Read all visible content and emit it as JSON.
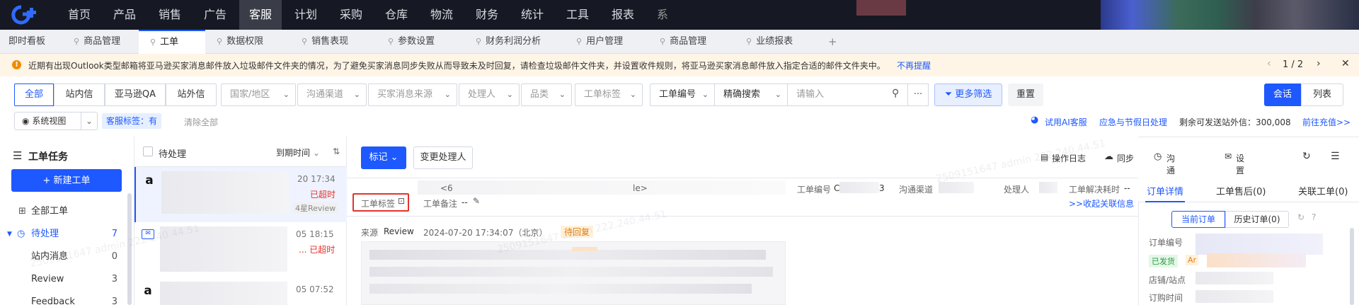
{
  "topnav": {
    "items": [
      "首页",
      "产品",
      "销售",
      "广告",
      "客服",
      "计划",
      "采购",
      "仓库",
      "物流",
      "财务",
      "统计",
      "工具",
      "报表",
      "系"
    ],
    "active_index": 4
  },
  "tabs": [
    {
      "label": "即时看板",
      "pinned": false
    },
    {
      "label": "商品管理",
      "pinned": true
    },
    {
      "label": "工单",
      "pinned": true,
      "active": true
    },
    {
      "label": "数据权限",
      "pinned": true
    },
    {
      "label": "销售表现",
      "pinned": true
    },
    {
      "label": "参数设置",
      "pinned": true
    },
    {
      "label": "财务利润分析",
      "pinned": true
    },
    {
      "label": "用户管理",
      "pinned": true
    },
    {
      "label": "商品管理",
      "pinned": true
    },
    {
      "label": "业绩报表",
      "pinned": true
    }
  ],
  "tab_add": "+",
  "notice": {
    "text": "近期有出现Outlook类型邮箱将亚马逊买家消息邮件放入垃圾邮件文件夹的情况，为了避免买家消息同步失败从而导致未及时回复，请检查垃圾邮件文件夹，并设置收件规则，将亚马逊买家消息邮件放入指定合适的邮件文件夹中。",
    "dismiss": "不再提醒",
    "pager": "1 / 2"
  },
  "filters": {
    "segments": [
      "全部",
      "站内信",
      "亚马逊QA",
      "站外信"
    ],
    "selects": [
      "国家/地区",
      "沟通渠道",
      "买家消息来源",
      "处理人",
      "品类",
      "工单标签"
    ],
    "ticket_no_label": "工单编号",
    "match_mode": "精确搜索",
    "search_placeholder": "请输入",
    "more_filter": "更多筛选",
    "reset": "重置",
    "view_modes": [
      "会话",
      "列表"
    ]
  },
  "row2": {
    "system_view": "系统视图",
    "tag_chip": "客服标签：有",
    "clear_all": "清除全部",
    "ai_service": "试用AI客服",
    "emergency": "应急与节假日处理",
    "quota": "剩余可发送站外信：300,008",
    "recharge": "前往充值>>"
  },
  "sidebar": {
    "title": "工单任务",
    "new_button": "+ 新建工单",
    "all": "全部工单",
    "pending": {
      "label": "待处理",
      "count": "7"
    },
    "children": [
      {
        "label": "站内消息",
        "count": "0"
      },
      {
        "label": "Review",
        "count": "3"
      },
      {
        "label": "Feedback",
        "count": "3"
      }
    ]
  },
  "list": {
    "header_label": "待处理",
    "sort_label": "到期时间",
    "items": [
      {
        "time": "20 17:34",
        "status": "已超时",
        "tag": "4星Review"
      },
      {
        "time": "05 18:15",
        "status": "... 已超时",
        "tag": ""
      },
      {
        "time": "05 07:52",
        "status": "",
        "tag": ""
      }
    ]
  },
  "detail": {
    "mark_button": "标记",
    "change_handler": "变更处理人",
    "toolbar": [
      "操作日志",
      "同步",
      "沟通记录",
      "设置站外邮箱"
    ],
    "row1": {
      "subject_left": "<6",
      "subject_right": "le>",
      "ticket_no_label": "工单编号",
      "ticket_no_value": "C",
      "ticket_no_tail": "3",
      "channel_label": "沟通渠道",
      "handler_label": "处理人",
      "resolve_label": "工单解决耗时",
      "resolve_value": "--"
    },
    "tags_label": "工单标签",
    "notes_label": "工单备注",
    "notes_value": "--",
    "collapse_link": ">>收起关联信息",
    "source_label": "来源",
    "source_value": "Review",
    "datetime": "2024-07-20 17:34:07（北京）",
    "reply_status": "待回复"
  },
  "right_panel": {
    "tabs": [
      "订单详情",
      "工单售后(0)",
      "关联工单(0)"
    ],
    "sub_tabs": [
      "当前订单",
      "历史订单(0)"
    ],
    "fields": [
      {
        "label": "订单编号"
      },
      {
        "label": "店铺/站点"
      },
      {
        "label": "订购时间"
      }
    ],
    "shipped_badge": "已发货",
    "badge_tail": "Ar"
  },
  "colors": {
    "primary": "#1e58ff",
    "danger": "#e5322d",
    "nav_bg": "#161923",
    "notice_bg": "#fff5e6"
  }
}
